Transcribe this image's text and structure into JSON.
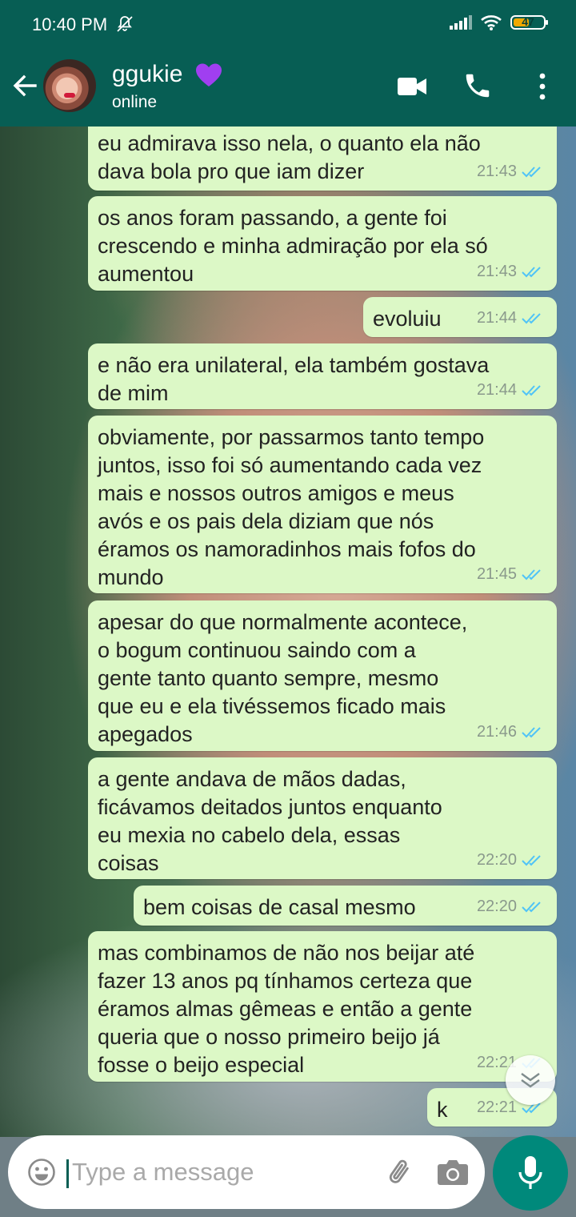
{
  "status_bar": {
    "time": "10:40 PM",
    "battery": "47"
  },
  "header": {
    "contact_name": "ggukie",
    "contact_status": "online"
  },
  "messages": [
    {
      "text": "eu admirava isso nela, o quanto ela não\ndava bola pro que iam dizer",
      "time": "21:43"
    },
    {
      "text": "os anos foram passando, a gente foi\ncrescendo e minha admiração por ela só\naumentou",
      "time": "21:43"
    },
    {
      "text": "evoluiu",
      "time": "21:44"
    },
    {
      "text": "e não era unilateral, ela também gostava\nde mim",
      "time": "21:44"
    },
    {
      "text": "obviamente, por passarmos tanto tempo\njuntos, isso foi só aumentando cada vez\nmais e nossos outros amigos e meus\navós e os pais dela diziam que nós\néramos os namoradinhos mais fofos do\nmundo",
      "time": "21:45"
    },
    {
      "text": "apesar do que normalmente acontece,\no bogum continuou saindo com a\ngente tanto quanto sempre, mesmo\nque eu e ela tivéssemos ficado mais\napegados",
      "time": "21:46"
    },
    {
      "text": "a gente andava de mãos dadas,\nficávamos deitados juntos enquanto\neu mexia no cabelo dela, essas\ncoisas",
      "time": "22:20"
    },
    {
      "text": "bem coisas de casal mesmo",
      "time": "22:20"
    },
    {
      "text": "mas combinamos de não nos beijar até\nfazer 13 anos pq tínhamos certeza que\néramos almas gêmeas e então a gente\nqueria que o nosso primeiro beijo já\nfosse o beijo especial",
      "time": "22:21"
    },
    {
      "text": "k",
      "time": "22:21"
    }
  ],
  "composer": {
    "placeholder": "Type a message"
  },
  "colors": {
    "header": "#075e54",
    "bubble_out": "#dcf8c6",
    "read_ticks": "#4fc3f7",
    "mic_button": "#00897b"
  },
  "icons": [
    "back-arrow-icon",
    "purple-heart-icon",
    "video-call-icon",
    "phone-icon",
    "more-vert-icon",
    "emoji-icon",
    "attach-icon",
    "camera-icon",
    "mic-icon",
    "double-check-icon",
    "scroll-down-icon"
  ]
}
